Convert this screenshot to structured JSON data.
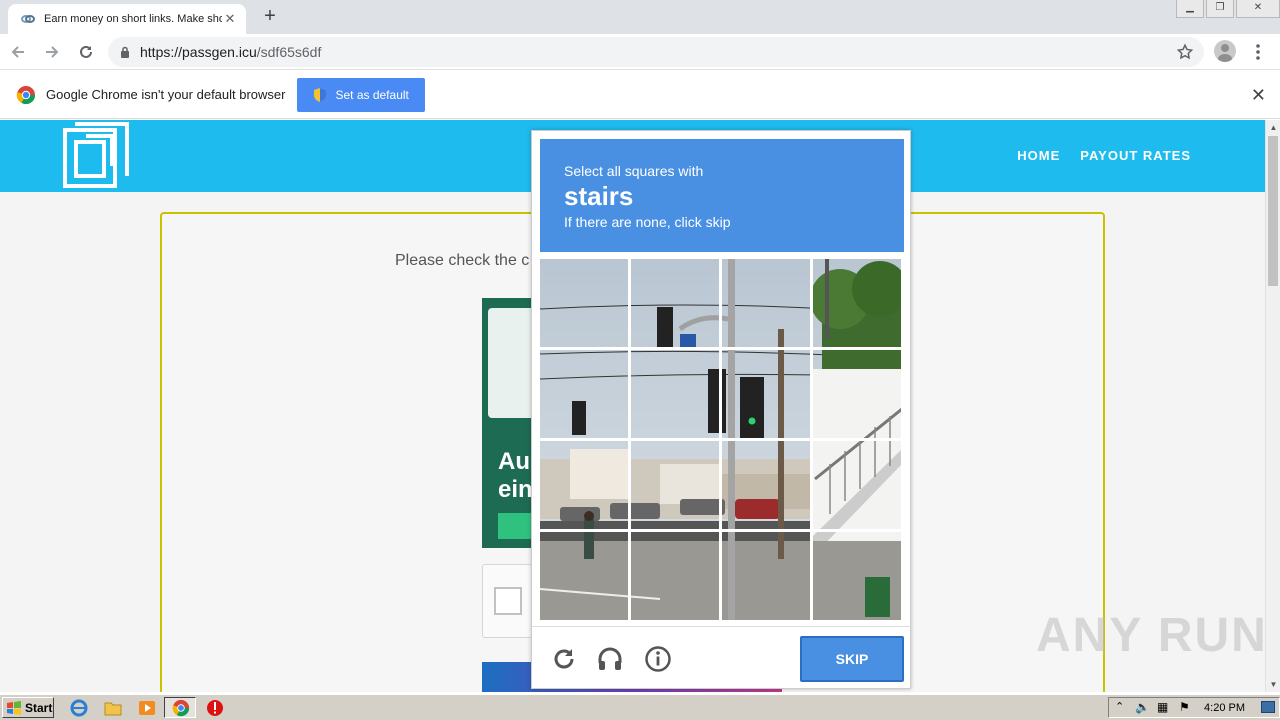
{
  "browser": {
    "tab_title": "Earn money on short links. Make short links and earn",
    "url_host": "https://passgen.icu",
    "url_path": "/sdf65s6df",
    "infobar_message": "Google Chrome isn't your default browser",
    "set_default_label": "Set as default"
  },
  "site": {
    "nav": [
      "HOME",
      "PAYOUT RATES"
    ],
    "hint_text": "Please check the c",
    "ad_text_line1": "Au",
    "ad_text_line2": "ein"
  },
  "captcha": {
    "line1": "Select all squares with",
    "target": "stairs",
    "line3": "If there are none, click skip",
    "skip_label": "SKIP",
    "icons": [
      "reload-icon",
      "audio-icon",
      "info-icon"
    ]
  },
  "watermark": "ANY RUN",
  "taskbar": {
    "start_label": "Start",
    "clock": "4:20 PM"
  },
  "colors": {
    "site_header": "#1ebbee",
    "captcha_blue": "#4a90e2",
    "card_border": "#c8c200"
  }
}
